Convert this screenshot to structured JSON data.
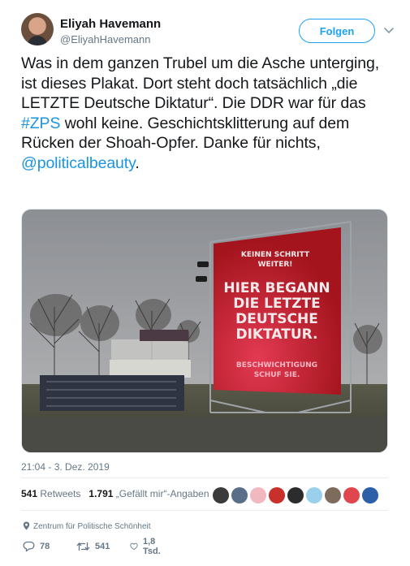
{
  "author": {
    "name": "Eliyah Havemann",
    "handle": "@EliyahHavemann"
  },
  "follow_label": "Folgen",
  "tweet": {
    "p1": "Was in dem ganzen Trubel um die Asche unterging, ist dieses Plakat. Dort steht doch tatsächlich „die LETZTE Deutsche Diktatur“. Die DDR war für das ",
    "hashtag": "#ZPS",
    "p2": " wohl keine. Geschichtsklitterung auf dem Rücken der Shoah-Opfer. Danke für nichts, ",
    "mention": "@politicalbeauty",
    "p3": "."
  },
  "photo": {
    "banner_small": [
      "KEINEN SCHRITT",
      "WEITER!"
    ],
    "banner_big": [
      "HIER BEGANN",
      "DIE LETZTE",
      "DEUTSCHE",
      "DIKTATUR."
    ],
    "banner_bottom": [
      "BESCHWICHTIGUNG",
      "SCHUF SIE."
    ]
  },
  "timestamp": "21:04 - 3. Dez. 2019",
  "stats": {
    "retweets_count": "541",
    "retweets_label": "Retweets",
    "likes_count": "1.791",
    "likes_label": "„Gefällt mir“-Angaben"
  },
  "liker_colors": [
    "#3b3b3b",
    "#5a6e8a",
    "#f2b8c0",
    "#c9302c",
    "#2c2c2c",
    "#9ad0ec",
    "#7d6b5c",
    "#e0464d",
    "#2b5fa8"
  ],
  "place": "Zentrum für Politische Schönheit",
  "actions": {
    "replies": "78",
    "retweets": "541",
    "likes": "1,8 Tsd."
  },
  "colors": {
    "accent": "#1da1f2",
    "link": "#1b95e0",
    "banner": "#a3141c"
  }
}
